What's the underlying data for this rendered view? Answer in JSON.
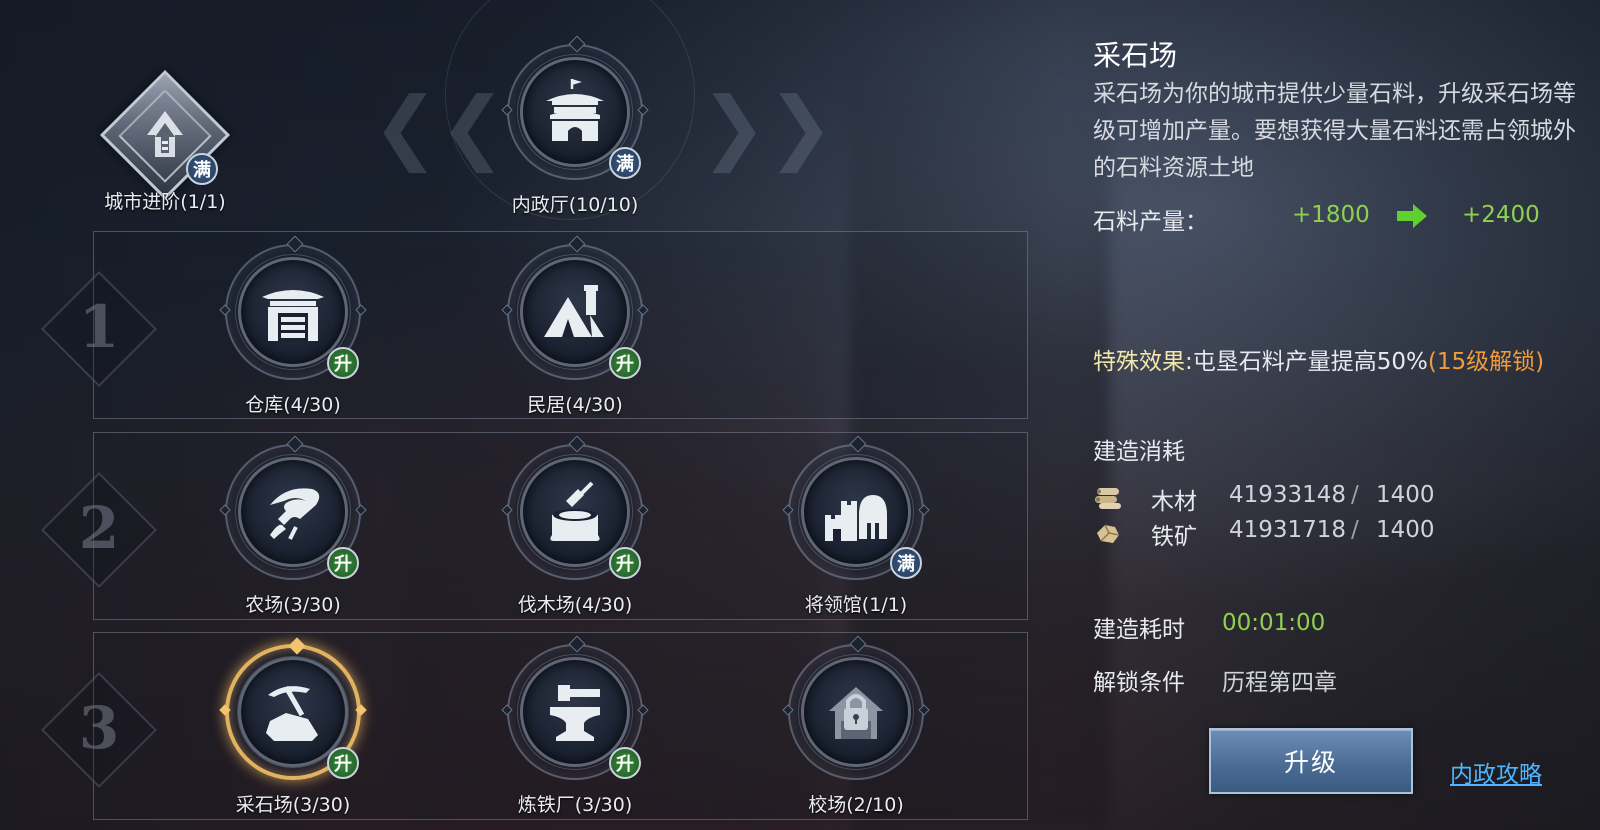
{
  "city_advance": {
    "label": "城市进阶(1/1)",
    "badge": "满"
  },
  "top_building": {
    "label": "内政厅(10/10)",
    "badge": "满"
  },
  "tiers": [
    "1",
    "2",
    "3"
  ],
  "buildings": {
    "warehouse": {
      "label": "仓库(4/30)",
      "badge": "升"
    },
    "residence": {
      "label": "民居(4/30)",
      "badge": "升"
    },
    "farm": {
      "label": "农场(3/30)",
      "badge": "升"
    },
    "lumberyard": {
      "label": "伐木场(4/30)",
      "badge": "升"
    },
    "general_hall": {
      "label": "将领馆(1/1)",
      "badge": "满"
    },
    "quarry": {
      "label": "采石场(3/30)",
      "badge": "升"
    },
    "ironworks": {
      "label": "炼铁厂(3/30)",
      "badge": "升"
    },
    "drill_ground": {
      "label": "校场(2/10)"
    }
  },
  "detail": {
    "title": "采石场",
    "description": "采石场为你的城市提供少量石料，升级采石场等级可增加产量。要想获得大量石料还需占领城外的石料资源土地",
    "production_label": "石料产量：",
    "production_current": "+1800",
    "production_next": "+2400",
    "special_label": "特殊效果:",
    "special_text": "屯垦石料产量提高50%",
    "special_unlock": "(15级解锁)",
    "cost_title": "建造消耗",
    "costs": [
      {
        "name": "木材",
        "have": "41933148",
        "sep": "/",
        "need": "1400",
        "icon": "wood-icon"
      },
      {
        "name": "铁矿",
        "have": "41931718",
        "sep": "/",
        "need": "1400",
        "icon": "iron-ore-icon"
      }
    ],
    "time_label": "建造耗时",
    "time_value": "00:01:00",
    "unlock_label": "解锁条件",
    "unlock_value": "历程第四章",
    "upgrade_button": "升级",
    "guide_link": "内政攻略"
  },
  "colors": {
    "green": "#8fd14f",
    "orange": "#f19a3b",
    "link": "#4fb4ff",
    "selected_ring": "#e3b260",
    "badge_upgrade": "#2f7a34",
    "badge_full": "#35517a"
  }
}
